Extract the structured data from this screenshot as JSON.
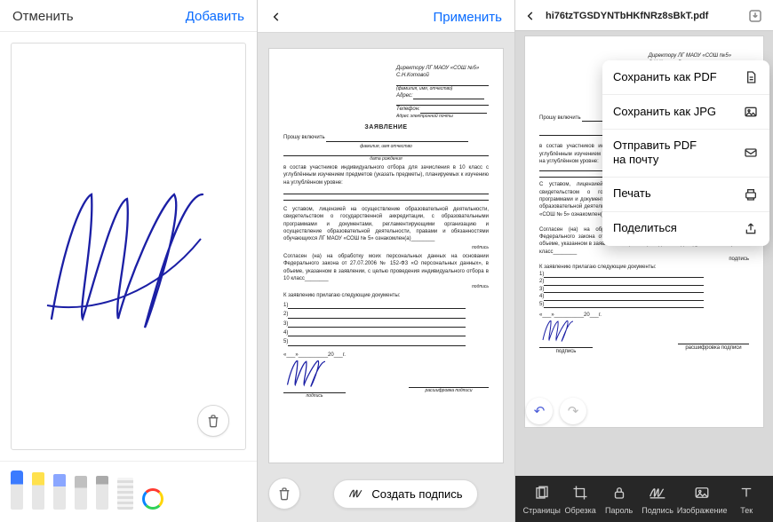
{
  "pane1": {
    "cancel": "Отменить",
    "add": "Добавить",
    "trash_icon": "trash"
  },
  "tools": [
    "pen",
    "marker",
    "pencil",
    "eraser",
    "knife",
    "ruler",
    "color"
  ],
  "pane2": {
    "apply": "Применить",
    "create_signature": "Создать подпись"
  },
  "document": {
    "header_to": "Директору ЛГ МАОУ «СОШ №5»",
    "header_name": "С.Н.Котовой",
    "fio_hint": "(фамилия, имя, отчество)",
    "addr_label": "Адрес:",
    "tel_label": "Телефон:",
    "email_label": "Адрес электронной почты",
    "title": "ЗАЯВЛЕНИЕ",
    "ask": "Прошу включить",
    "fio_line": "фамилия, имя отчество",
    "dob": "дата рождения",
    "body1": "в состав участников индивидуального отбора для зачисления в 10 класс с углублённым изучением предметов (указать предметы), планируемых к изучению на углублённом уровне:",
    "body2": "С уставом, лицензией на осуществление образовательной деятельности, свидетельством о государственной аккредитации, с образовательными программами и документами, регламентирующими организацию и осуществление образовательной деятельности, правами и обязанностями обучающихся ЛГ МАОУ «СОШ № 5» ознакомлен(а)________",
    "body3": "Согласен (на) на обработку моих персональных данных на основании Федерального закона от 27.07.2006 № 152-ФЗ «О персональных данных», в объеме, указанном в заявлении, с целью проведения индивидуального отбора в 10 класс________",
    "sign_small": "подпись",
    "apps": "К заявлению прилагаю следующие документы:",
    "list": [
      "1)",
      "2)",
      "3)",
      "4)",
      "5)"
    ],
    "date_row": "«___»__________20___г.",
    "sig_label": "подпись",
    "decode": "расшифровка подписи"
  },
  "pane3": {
    "filename": "hi76tzTGSDYNTbHKfNRz8sBkT.pdf",
    "menu": [
      {
        "label": "Сохранить как PDF",
        "icon": "doc"
      },
      {
        "label": "Сохранить как JPG",
        "icon": "image"
      },
      {
        "label": "Отправить PDF\nна почту",
        "icon": "mail"
      },
      {
        "label": "Печать",
        "icon": "print"
      },
      {
        "label": "Поделиться",
        "icon": "share"
      }
    ],
    "toolbar": [
      {
        "label": "Страницы",
        "icon": "pages"
      },
      {
        "label": "Обрезка",
        "icon": "crop"
      },
      {
        "label": "Пароль",
        "icon": "lock"
      },
      {
        "label": "Подпись",
        "icon": "sig"
      },
      {
        "label": "Изображение",
        "icon": "img"
      },
      {
        "label": "Тек",
        "icon": "text"
      }
    ]
  }
}
